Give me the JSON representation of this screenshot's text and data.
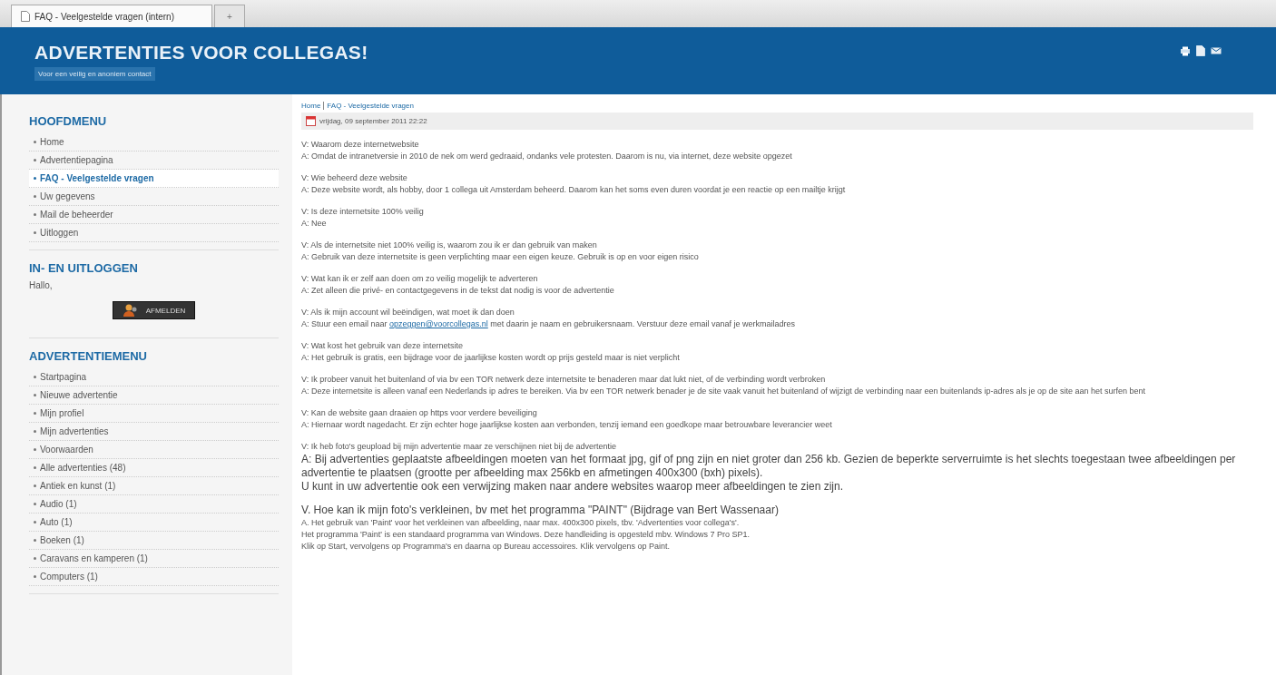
{
  "browser_tabs": [
    {
      "title": "FAQ - Veelgestelde vragen (intern)",
      "selected": true,
      "kind": "page"
    },
    {
      "title": "+",
      "selected": false,
      "kind": "new"
    }
  ],
  "header": {
    "title": "ADVERTENTIES VOOR COLLEGAS!",
    "subtitle": "Voor een veilig en anoniem contact"
  },
  "sidebar": [
    {
      "kind": "menu",
      "heading": "HOOFDMENU",
      "items": [
        {
          "label": "Home",
          "selected": false
        },
        {
          "label": "Advertentiepagina",
          "selected": false
        },
        {
          "label": "FAQ - Veelgestelde vragen",
          "selected": true
        },
        {
          "label": "Uw gegevens",
          "selected": false
        },
        {
          "label": "Mail de beheerder",
          "selected": false
        },
        {
          "label": "Uitloggen",
          "selected": false
        }
      ]
    },
    {
      "kind": "login",
      "heading": "IN- EN UITLOGGEN",
      "greeting": "Hallo,",
      "button": "AFMELDEN"
    },
    {
      "kind": "menu",
      "heading": "ADVERTENTIEMENU",
      "items": [
        {
          "label": "Startpagina",
          "selected": false
        },
        {
          "label": "Nieuwe advertentie",
          "selected": false
        },
        {
          "label": "Mijn profiel",
          "selected": false
        },
        {
          "label": "Mijn advertenties",
          "selected": false
        },
        {
          "label": "Voorwaarden",
          "selected": false
        },
        {
          "label": "Alle advertenties (48)",
          "selected": false
        },
        {
          "label": "Antiek en kunst (1)",
          "selected": false
        },
        {
          "label": "Audio (1)",
          "selected": false
        },
        {
          "label": "Auto (1)",
          "selected": false
        },
        {
          "label": "Boeken (1)",
          "selected": false
        },
        {
          "label": "Caravans en kamperen (1)",
          "selected": false
        },
        {
          "label": "Computers (1)",
          "selected": false
        }
      ]
    }
  ],
  "breadcrumb": [
    "Home",
    "FAQ - Veelgestelde vragen"
  ],
  "date": "vrijdag, 09 september 2011 22:22",
  "faq": [
    {
      "kind": "small",
      "question": "V: Waarom deze internetwebsite",
      "answer": [
        [
          {
            "kind": "text",
            "text": "A: Omdat de intranetversie in 2010 de nek om werd gedraaid, ondanks vele protesten. Daarom is nu, via internet, deze website opgezet"
          }
        ]
      ]
    },
    {
      "kind": "small",
      "question": "V: Wie beheerd deze website",
      "answer": [
        [
          {
            "kind": "text",
            "text": "A: Deze website wordt, als hobby, door 1 collega uit Amsterdam beheerd. Daarom kan het soms even duren voordat je een reactie op een mailtje krijgt"
          }
        ]
      ]
    },
    {
      "kind": "small",
      "question": "V: Is deze internetsite 100% veilig",
      "answer": [
        [
          {
            "kind": "text",
            "text": "A: Nee"
          }
        ]
      ]
    },
    {
      "kind": "small",
      "question": "V: Als de internetsite niet 100% veilig is, waarom zou ik er dan gebruik van maken",
      "answer": [
        [
          {
            "kind": "text",
            "text": "A: Gebruik van deze internetsite is geen verplichting maar een eigen keuze. Gebruik is op en voor eigen risico"
          }
        ]
      ]
    },
    {
      "kind": "small",
      "question": "V: Wat kan ik er zelf aan doen om zo veilig mogelijk te adverteren",
      "answer": [
        [
          {
            "kind": "text",
            "text": "A: Zet alleen die privé- en contactgegevens in de tekst dat nodig is voor de advertentie"
          }
        ]
      ]
    },
    {
      "kind": "small",
      "question": "V: Als ik mijn account wil beëindigen, wat moet ik dan doen",
      "answer": [
        [
          {
            "kind": "text",
            "text": "A: Stuur een email naar "
          },
          {
            "kind": "link",
            "text": "opzeggen@voorcollegas.nl"
          },
          {
            "kind": "text",
            "text": " met daarin je naam en gebruikersnaam. Verstuur deze email vanaf je werkmailadres"
          }
        ]
      ]
    },
    {
      "kind": "small",
      "question": "V: Wat kost het gebruik van deze internetsite",
      "answer": [
        [
          {
            "kind": "text",
            "text": "A: Het gebruik is gratis, een bijdrage voor de jaarlijkse kosten wordt op prijs gesteld maar is niet verplicht"
          }
        ]
      ]
    },
    {
      "kind": "small",
      "question": "V: Ik probeer vanuit het buitenland of via bv een TOR netwerk deze internetsite te benaderen maar dat lukt niet, of de verbinding wordt verbroken",
      "answer": [
        [
          {
            "kind": "text",
            "text": "A: Deze internetsite is alleen vanaf een Nederlands ip adres te bereiken. Via bv een TOR netwerk benader je de site vaak vanuit het buitenland of wijzigt de verbinding naar een buitenlands ip-adres als je op de site aan het surfen bent"
          }
        ]
      ]
    },
    {
      "kind": "small",
      "question": "V: Kan de website gaan draaien op https voor verdere beveiliging",
      "answer": [
        [
          {
            "kind": "text",
            "text": "A: Hiernaar wordt nagedacht. Er zijn echter hoge jaarlijkse kosten aan verbonden, tenzij iemand een goedkope maar betrouwbare leverancier weet"
          }
        ]
      ]
    },
    {
      "kind": "mixed",
      "question": "V: Ik heb foto's geupload bij mijn advertentie maar ze verschijnen niet bij de advertentie",
      "answer": [
        [
          {
            "kind": "text",
            "text": "A: Bij advertenties geplaatste afbeeldingen moeten van het formaat jpg, gif of png zijn en niet groter dan 256 kb. Gezien de beperkte serverruimte is het slechts toegestaan twee afbeeldingen per advertentie te plaatsen (grootte per afbeelding max 256kb en afmetingen 400x300 (bxh) pixels)."
          }
        ],
        [
          {
            "kind": "text",
            "text": "U kunt in uw advertentie ook een verwijzing maken naar andere websites waarop meer afbeeldingen te zien zijn."
          }
        ]
      ]
    },
    {
      "kind": "large",
      "question": "V. Hoe kan ik mijn foto's verkleinen, bv met het programma \"PAINT\" (Bijdrage van Bert Wassenaar)",
      "answer": [
        [
          {
            "kind": "text",
            "text": "A. Het gebruik van 'Paint' voor het verkleinen van afbeelding, naar max. 400x300 pixels, tbv. 'Advertenties voor collega's'."
          }
        ],
        [
          {
            "kind": "text",
            "text": "Het programma 'Paint' is een standaard programma van Windows. Deze handleiding is opgesteld mbv. Windows 7 Pro SP1."
          }
        ],
        [
          {
            "kind": "text",
            "text": "Klik op Start, vervolgens op Programma's en daarna op Bureau accessoires. Klik vervolgens op Paint."
          }
        ]
      ]
    }
  ]
}
